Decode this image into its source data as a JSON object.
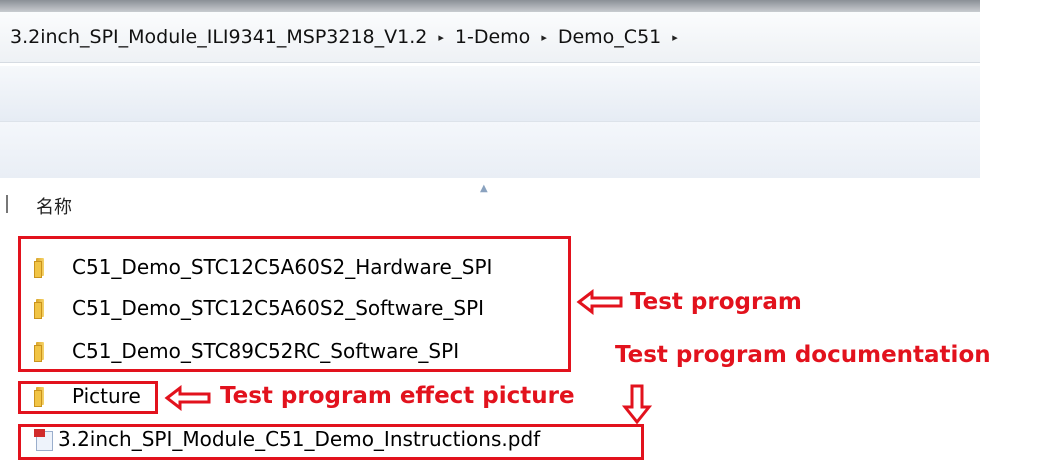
{
  "breadcrumb": {
    "items": [
      "3.2inch_SPI_Module_ILI9341_MSP3218_V1.2",
      "1-Demo",
      "Demo_C51"
    ],
    "separator": "▸"
  },
  "columns": {
    "name": "名称"
  },
  "files": [
    {
      "name": "C51_Demo_STC12C5A60S2_Hardware_SPI",
      "type": "folder"
    },
    {
      "name": "C51_Demo_STC12C5A60S2_Software_SPI",
      "type": "folder"
    },
    {
      "name": "C51_Demo_STC89C52RC_Software_SPI",
      "type": "folder"
    },
    {
      "name": "Picture",
      "type": "folder"
    },
    {
      "name": "3.2inch_SPI_Module_C51_Demo_Instructions.pdf",
      "type": "pdf"
    }
  ],
  "annotations": {
    "test_program": "Test program",
    "documentation": "Test program documentation",
    "effect_picture": "Test program effect picture",
    "color": "#e2121d"
  }
}
